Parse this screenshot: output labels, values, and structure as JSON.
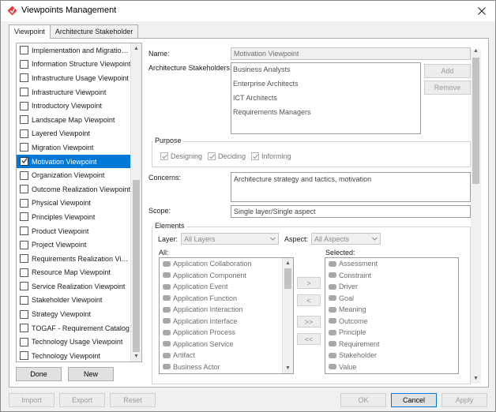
{
  "window": {
    "title": "Viewpoints Management"
  },
  "tabs": [
    {
      "label": "Viewpoint",
      "active": true
    },
    {
      "label": "Architecture Stakeholder",
      "active": false
    }
  ],
  "viewpoint_list": {
    "items": [
      {
        "label": "Implementation and Migration ...",
        "checked": false
      },
      {
        "label": "Information Structure Viewpoint",
        "checked": false
      },
      {
        "label": "Infrastructure Usage Viewpoint",
        "checked": false
      },
      {
        "label": "Infrastructure Viewpoint",
        "checked": false
      },
      {
        "label": "Introductory Viewpoint",
        "checked": false
      },
      {
        "label": "Landscape Map Viewpoint",
        "checked": false
      },
      {
        "label": "Layered Viewpoint",
        "checked": false
      },
      {
        "label": "Migration Viewpoint",
        "checked": false
      },
      {
        "label": "Motivation Viewpoint",
        "checked": true,
        "selected": true
      },
      {
        "label": "Organization Viewpoint",
        "checked": false
      },
      {
        "label": "Outcome Realization Viewpoint",
        "checked": false
      },
      {
        "label": "Physical Viewpoint",
        "checked": false
      },
      {
        "label": "Principles Viewpoint",
        "checked": false
      },
      {
        "label": "Product Viewpoint",
        "checked": false
      },
      {
        "label": "Project Viewpoint",
        "checked": false
      },
      {
        "label": "Requirements Realization View...",
        "checked": false
      },
      {
        "label": "Resource Map Viewpoint",
        "checked": false
      },
      {
        "label": "Service Realization Viewpoint",
        "checked": false
      },
      {
        "label": "Stakeholder Viewpoint",
        "checked": false
      },
      {
        "label": "Strategy Viewpoint",
        "checked": false
      },
      {
        "label": "TOGAF - Requirement Catalog",
        "checked": false
      },
      {
        "label": "Technology Usage Viewpoint",
        "checked": false
      },
      {
        "label": "Technology Viewpoint",
        "checked": false
      }
    ],
    "done_label": "Done",
    "new_label": "New"
  },
  "details": {
    "name_label": "Name:",
    "name_value": "Motivation Viewpoint",
    "stakeholders_label": "Architecture Stakeholders:",
    "stakeholders": [
      "Business Analysts",
      "Enterprise Architects",
      "ICT Architects",
      "Requirements Managers"
    ],
    "add_label": "Add",
    "remove_label": "Remove",
    "purpose_label": "Purpose",
    "purpose_options": [
      {
        "label": "Designing",
        "checked": true
      },
      {
        "label": "Deciding",
        "checked": true
      },
      {
        "label": "Informing",
        "checked": true
      }
    ],
    "concerns_label": "Concerns:",
    "concerns_value": "Architecture strategy and tactics, motivation",
    "scope_label": "Scope:",
    "scope_value": "Single layer/Single aspect",
    "elements": {
      "title": "Elements",
      "layer_label": "Layer:",
      "layer_value": "All Layers",
      "aspect_label": "Aspect:",
      "aspect_value": "All Aspects",
      "all_label": "All:",
      "selected_label": "Selected:",
      "all_items": [
        "Application Collaboration",
        "Application Component",
        "Application Event",
        "Application Function",
        "Application Interaction",
        "Application Interface",
        "Application Process",
        "Application Service",
        "Artifact",
        "Business Actor"
      ],
      "selected_items": [
        "Assessment",
        "Constraint",
        "Driver",
        "Goal",
        "Meaning",
        "Outcome",
        "Principle",
        "Requirement",
        "Stakeholder",
        "Value"
      ],
      "move_right": ">",
      "move_left": "<",
      "move_all_right": ">>",
      "move_all_left": "<<"
    }
  },
  "footer": {
    "import_label": "Import",
    "export_label": "Export",
    "reset_label": "Reset",
    "ok_label": "OK",
    "cancel_label": "Cancel",
    "apply_label": "Apply"
  },
  "colors": {
    "selection": "#0078d7",
    "app_icon": "#e03c3c",
    "element_icon": "#a8a8a8"
  }
}
